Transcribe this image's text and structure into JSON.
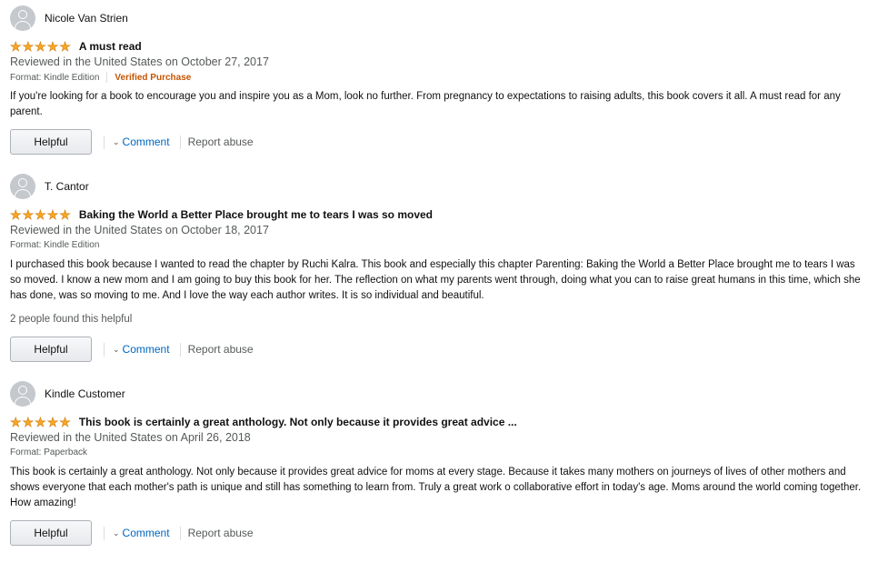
{
  "reviews": [
    {
      "author": "Nicole Van Strien",
      "rating": 5,
      "title": "A must read",
      "date": "Reviewed in the United States on October 27, 2017",
      "format": "Format: Kindle Edition",
      "verified": "Verified Purchase",
      "body": "If you're looking for a book to encourage you and inspire you as a Mom, look no further. From pregnancy to expectations to raising adults, this book covers it all. A must read for any parent.",
      "helpful_count": "",
      "helpful_label": "Helpful",
      "comment_label": "Comment",
      "report_label": "Report abuse"
    },
    {
      "author": "T. Cantor",
      "rating": 5,
      "title": "Baking the World a Better Place brought me to tears I was so moved",
      "date": "Reviewed in the United States on October 18, 2017",
      "format": "Format: Kindle Edition",
      "verified": "",
      "body": "I purchased this book because I wanted to read the chapter by Ruchi Kalra. This book and especially this chapter Parenting: Baking the World a Better Place brought me to tears I was so moved. I know a new mom and I am going to buy this book for her. The reflection on what my parents went through, doing what you can to raise great humans in this time, which she has done, was so moving to me. And I love the way each author writes. It is so individual and beautiful.",
      "helpful_count": "2 people found this helpful",
      "helpful_label": "Helpful",
      "comment_label": "Comment",
      "report_label": "Report abuse"
    },
    {
      "author": "Kindle Customer",
      "rating": 5,
      "title": "This book is certainly a great anthology. Not only because it provides great advice ...",
      "date": "Reviewed in the United States on April 26, 2018",
      "format": "Format: Paperback",
      "verified": "",
      "body": "This book is certainly a great anthology. Not only because it provides great advice for moms at every stage. Because it takes many mothers on journeys of lives of other mothers and shows everyone that each mother's path is unique and still has something to learn from. Truly a great work o collaborative effort in today's age. Moms around the world coming together. How amazing!",
      "helpful_count": "",
      "helpful_label": "Helpful",
      "comment_label": "Comment",
      "report_label": "Report abuse"
    }
  ],
  "icons": {
    "avatar": "default-user-avatar-icon",
    "star": "star-icon",
    "chevron": "chevron-down-icon"
  },
  "colors": {
    "star": "#f7a823",
    "link": "#0066c0",
    "verified": "#c45500",
    "muted_text": "#565959"
  }
}
